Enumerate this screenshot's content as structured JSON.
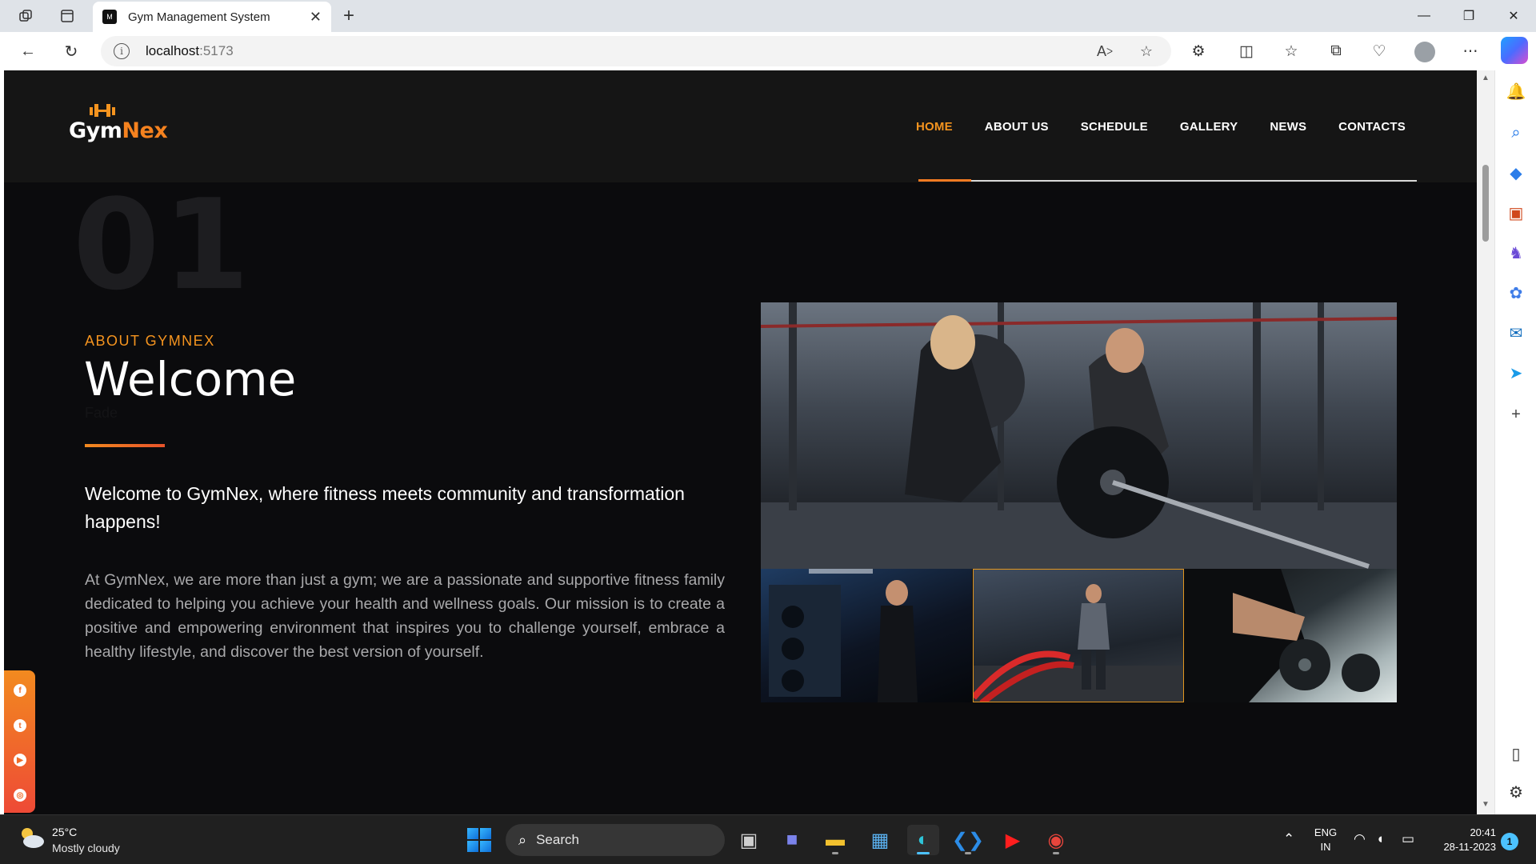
{
  "browser": {
    "tab_title": "Gym Management System",
    "tab_favicon": "gymnex-favicon",
    "url_host": "localhost",
    "url_port": ":5173",
    "icons": [
      "workspaces-icon",
      "tab-actions-icon",
      "back-icon",
      "refresh-icon",
      "info-icon",
      "read-aloud-icon",
      "favorite-star-icon",
      "extensions-icon",
      "split-screen-icon",
      "favorites-icon",
      "collections-icon",
      "browser-essentials-icon",
      "profile-icon",
      "more-icon",
      "copilot-icon"
    ]
  },
  "edge_sidebar": [
    "bell-icon",
    "search-icon",
    "shopping-tag-icon",
    "tools-briefcase-icon",
    "games-icon",
    "microsoft365-icon",
    "outlook-icon",
    "send-icon",
    "add-icon",
    "sidebar-toggle-icon",
    "settings-icon"
  ],
  "site": {
    "logo_part1": "Gym",
    "logo_part2": "Nex",
    "nav": [
      {
        "label": "HOME",
        "active": true
      },
      {
        "label": "ABOUT US",
        "active": false
      },
      {
        "label": "SCHEDULE",
        "active": false
      },
      {
        "label": "GALLERY",
        "active": false
      },
      {
        "label": "NEWS",
        "active": false
      },
      {
        "label": "CONTACTS",
        "active": false
      }
    ],
    "section_number": "01",
    "kicker": "ABOUT GYMNEX",
    "title": "Welcome",
    "faded_text": "Fade",
    "lead": "Welcome to GymNex, where fitness meets community and transformation happens!",
    "body": "At GymNex, we are more than just a gym; we are a passionate and supportive fitness family dedicated to helping you achieve your health and wellness goals. Our mission is to create a positive and empowering environment that inspires you to challenge yourself, embrace a healthy lifestyle, and discover the best version of yourself.",
    "social": [
      "facebook-icon",
      "twitter-icon",
      "youtube-icon",
      "instagram-icon"
    ],
    "colors": {
      "accent": "#f5941f",
      "accent_end": "#ee4a36",
      "background": "#0b0b0d",
      "header": "#151515"
    }
  },
  "taskbar": {
    "weather_temp": "25°C",
    "weather_desc": "Mostly cloudy",
    "search_label": "Search",
    "lang_1": "ENG",
    "lang_2": "IN",
    "time": "20:41",
    "date": "28-11-2023",
    "notification_count": "1"
  }
}
